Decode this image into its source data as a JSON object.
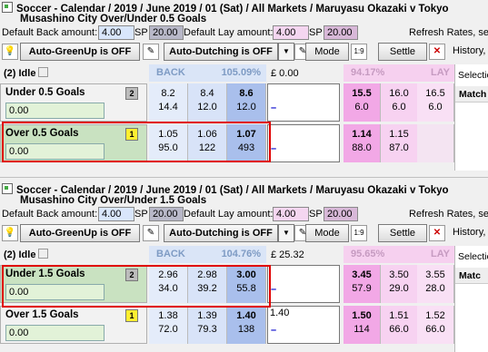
{
  "panels": [
    {
      "title": "Soccer - Calendar / 2019 / June 2019 / 01 (Sat) / All Markets / Maruyasu Okazaki v Tokyo",
      "subtitle": "Musashino City Over/Under 0.5 Goals",
      "default_back_label": "Default Back amount:",
      "default_back_value": "4.00",
      "sp_label": "SP",
      "sp_value": "20.00",
      "default_lay_label": "Default Lay amount:",
      "default_lay_value": "4.00",
      "sp_lay_value": "20.00",
      "refresh_label": "Refresh Rates, se",
      "autogreen_label": "Auto-GreenUp is OFF",
      "autodutch_label": "Auto-Dutching is OFF",
      "mode_label": "Mode",
      "settle_label": "Settle",
      "history_label": "History,",
      "idle_label": "(2) Idle",
      "back_label": "BACK",
      "back_pct": "105.09%",
      "gbp": "£ 0.00",
      "lay_pct": "94.17%",
      "lay_label": "LAY",
      "side_header": "Selectio",
      "side_header2": "Match",
      "runners": [
        {
          "name": "Under 0.5 Goals",
          "badge": "2",
          "pnl": "0.00",
          "back": [
            {
              "p": "8.2",
              "v": "14.4"
            },
            {
              "p": "8.4",
              "v": "12.0"
            },
            {
              "p": "8.6",
              "v": "12.0"
            }
          ],
          "bet": "",
          "lay": [
            {
              "p": "15.5",
              "v": "6.0"
            },
            {
              "p": "16.0",
              "v": "6.0"
            },
            {
              "p": "16.5",
              "v": "6.0"
            }
          ]
        },
        {
          "name": "Over 0.5 Goals",
          "badge": "1",
          "pnl": "0.00",
          "back": [
            {
              "p": "1.05",
              "v": "95.0"
            },
            {
              "p": "1.06",
              "v": "122"
            },
            {
              "p": "1.07",
              "v": "493"
            }
          ],
          "bet": "",
          "lay": [
            {
              "p": "1.14",
              "v": "88.0"
            },
            {
              "p": "1.15",
              "v": "87.0"
            },
            {
              "p": "",
              "v": ""
            }
          ]
        }
      ]
    },
    {
      "title": "Soccer - Calendar / 2019 / June 2019 / 01 (Sat) / All Markets / Maruyasu Okazaki v Tokyo",
      "subtitle": "Musashino City Over/Under 1.5 Goals",
      "default_back_label": "Default Back amount:",
      "default_back_value": "4.00",
      "sp_label": "SP",
      "sp_value": "20.00",
      "default_lay_label": "Default Lay amount:",
      "default_lay_value": "4.00",
      "sp_lay_value": "20.00",
      "refresh_label": "Refresh Rates, se",
      "autogreen_label": "Auto-GreenUp is OFF",
      "autodutch_label": "Auto-Dutching is OFF",
      "mode_label": "Mode",
      "settle_label": "Settle",
      "history_label": "History,",
      "idle_label": "(2) Idle",
      "back_label": "BACK",
      "back_pct": "104.76%",
      "gbp": "£ 25.32",
      "lay_pct": "95.65%",
      "lay_label": "LAY",
      "side_header": "Selectio",
      "side_header2": "Matc",
      "runners": [
        {
          "name": "Under 1.5 Goals",
          "badge": "2",
          "pnl": "0.00",
          "back": [
            {
              "p": "2.96",
              "v": "34.0"
            },
            {
              "p": "2.98",
              "v": "39.2"
            },
            {
              "p": "3.00",
              "v": "55.8"
            }
          ],
          "bet": "",
          "lay": [
            {
              "p": "3.45",
              "v": "57.9"
            },
            {
              "p": "3.50",
              "v": "29.0"
            },
            {
              "p": "3.55",
              "v": "28.0"
            }
          ]
        },
        {
          "name": "Over 1.5 Goals",
          "badge": "1",
          "pnl": "0.00",
          "back": [
            {
              "p": "1.38",
              "v": "72.0"
            },
            {
              "p": "1.39",
              "v": "79.3"
            },
            {
              "p": "1.40",
              "v": "138"
            }
          ],
          "bet": "1.40",
          "lay": [
            {
              "p": "1.50",
              "v": "114"
            },
            {
              "p": "1.51",
              "v": "66.0"
            },
            {
              "p": "1.52",
              "v": "66.0"
            }
          ]
        }
      ]
    }
  ]
}
